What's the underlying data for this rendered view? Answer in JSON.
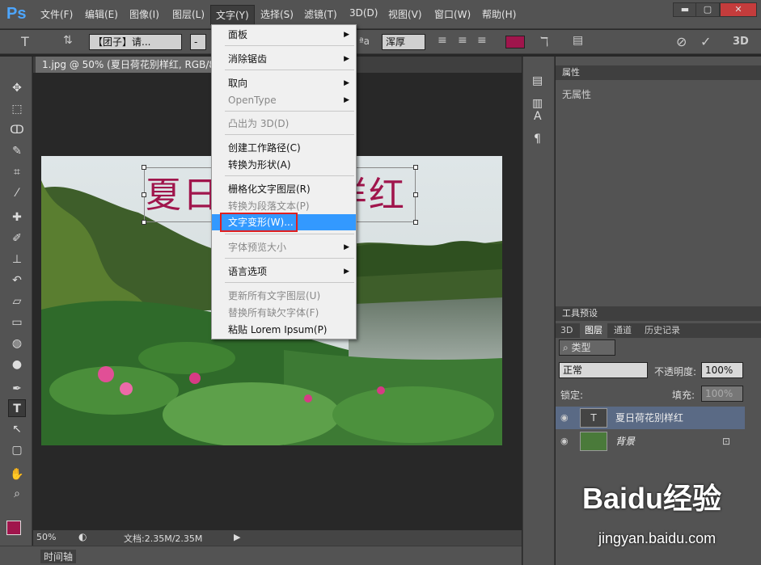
{
  "app": {
    "logo": "Ps"
  },
  "menubar": {
    "items": [
      "文件(F)",
      "编辑(E)",
      "图像(I)",
      "图层(L)",
      "文字(Y)",
      "选择(S)",
      "滤镜(T)",
      "3D(D)",
      "视图(V)",
      "窗口(W)",
      "帮助(H)"
    ],
    "active_index": 4
  },
  "window_controls": {
    "minimize": "▬",
    "maximize": "▢",
    "close": "✕"
  },
  "options": {
    "tool_glyph": "T",
    "font_family": "【团子】请...",
    "font_style": "-",
    "aa_label": "ªa",
    "aa_mode": "浑厚",
    "color": "#a0154c",
    "mode_3d": "3D"
  },
  "document": {
    "tab_title": "1.jpg @ 50% (夏日荷花别样红, RGB/8#)",
    "text_layer": "夏日荷花别样红",
    "zoom": "50%",
    "doc_size": "文档:2.35M/2.35M"
  },
  "type_menu": {
    "items": [
      {
        "label": "面板",
        "submenu": true,
        "disabled": false
      },
      {
        "label": "消除锯齿",
        "submenu": true,
        "disabled": false
      },
      {
        "label": "取向",
        "submenu": true,
        "disabled": false
      },
      {
        "label": "OpenType",
        "submenu": true,
        "disabled": true
      },
      {
        "label": "凸出为 3D(D)",
        "submenu": false,
        "disabled": true
      },
      {
        "label": "创建工作路径(C)",
        "submenu": false,
        "disabled": false
      },
      {
        "label": "转换为形状(A)",
        "submenu": false,
        "disabled": false
      },
      {
        "label": "栅格化文字图层(R)",
        "submenu": false,
        "disabled": false
      },
      {
        "label": "转换为段落文本(P)",
        "submenu": false,
        "disabled": true
      },
      {
        "label": "文字变形(W)...",
        "submenu": false,
        "disabled": false,
        "highlighted": true
      },
      {
        "label": "字体预览大小",
        "submenu": true,
        "disabled": true
      },
      {
        "label": "语言选项",
        "submenu": true,
        "disabled": false
      },
      {
        "label": "更新所有文字图层(U)",
        "submenu": false,
        "disabled": true
      },
      {
        "label": "替换所有缺欠字体(F)",
        "submenu": false,
        "disabled": true
      },
      {
        "label": "粘贴 Lorem Ipsum(P)",
        "submenu": false,
        "disabled": false
      }
    ]
  },
  "properties_panel": {
    "title": "属性",
    "empty_text": "无属性"
  },
  "tool_presets_panel": {
    "title": "工具预设"
  },
  "layers_panel": {
    "tabs": [
      "3D",
      "图层",
      "通道",
      "历史记录"
    ],
    "active_tab": 1,
    "filter_label": "类型",
    "blend_mode": "正常",
    "opacity_label": "不透明度:",
    "opacity_value": "100%",
    "lock_label": "锁定:",
    "fill_label": "填充:",
    "fill_value": "100%",
    "layers": [
      {
        "name": "夏日荷花别样红",
        "kind": "text",
        "selected": true
      },
      {
        "name": "背景",
        "kind": "image",
        "selected": false,
        "locked": true
      }
    ]
  },
  "timeline": {
    "label": "时间轴"
  },
  "watermark": {
    "brand": "Baidu经验",
    "url": "jingyan.baidu.com"
  }
}
